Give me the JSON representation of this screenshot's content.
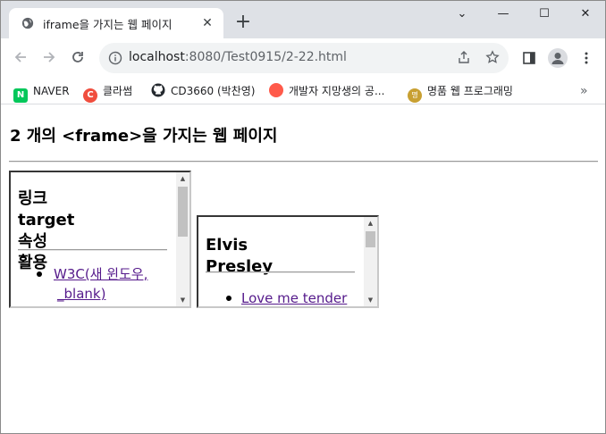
{
  "browser": {
    "tab_title": "iframe을 가지는 웹 페이지",
    "tab_close": "✕",
    "new_tab": "+",
    "url_host": "localhost",
    "url_rest": ":8080/Test0915/2-22.html",
    "controls": {
      "minimize": "—",
      "maximize": "☐",
      "close": "✕",
      "tab_search": "⌄"
    }
  },
  "bookmarks": [
    {
      "label": "NAVER",
      "icon": "naver-icon",
      "color": "#03c75a",
      "glyph": "N"
    },
    {
      "label": "클라썸",
      "icon": "classum-icon",
      "color": "#f04e3e",
      "glyph": "C"
    },
    {
      "label": "CD3660 (박찬영)",
      "icon": "github-icon",
      "color": "#24292f",
      "glyph": ""
    },
    {
      "label": "개발자 지망생의 공...",
      "icon": "blog-icon",
      "color": "#ff5a4a",
      "glyph": ""
    },
    {
      "label": "명품 웹 프로그래밍",
      "icon": "book-icon",
      "color": "#c8a032",
      "glyph": "명"
    }
  ],
  "bookmarks_more": "»",
  "page": {
    "heading": "2 개의 <frame>을 가지는 웹 페이지"
  },
  "frame1": {
    "heading_line1": "링크 target 속성",
    "heading_line2": "활용",
    "items": [
      "W3C(새 윈도우,",
      "_blank)"
    ]
  },
  "frame2": {
    "heading": "Elvis Presley",
    "items": [
      "Love me tender"
    ]
  },
  "colors": {
    "link_visited": "#551a8b",
    "tabstrip": "#dee1e6",
    "omnibox": "#f1f3f4"
  }
}
